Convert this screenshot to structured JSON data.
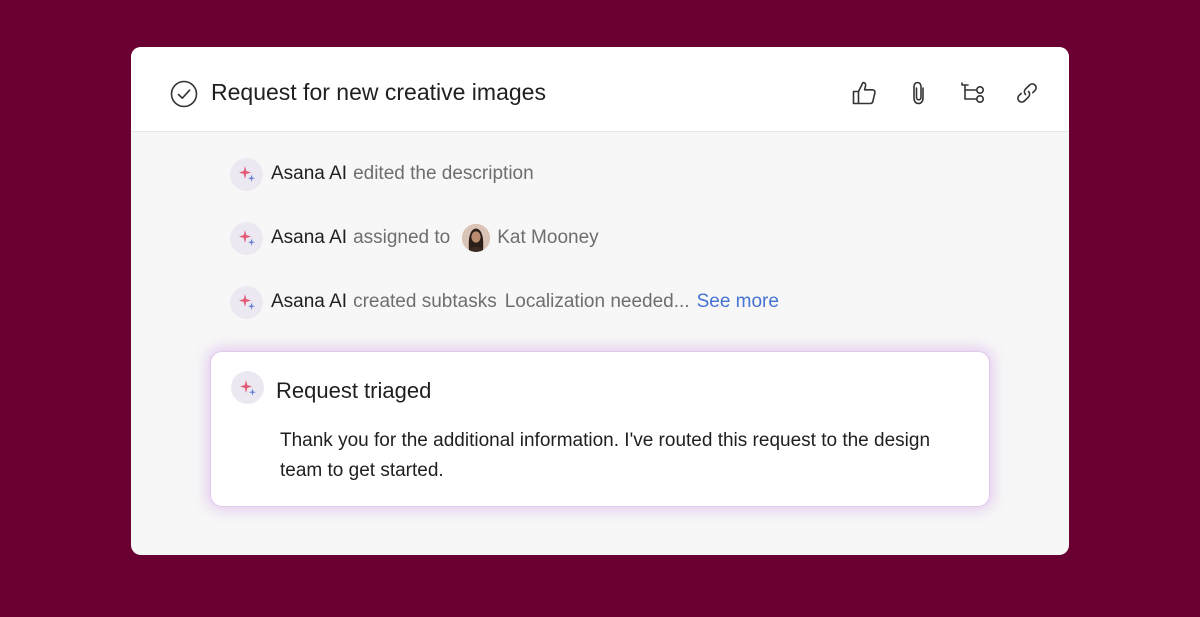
{
  "task": {
    "title": "Request for new creative images",
    "actions": [
      {
        "icon": "thumbs-up-icon",
        "label": "Like"
      },
      {
        "icon": "paperclip-icon",
        "label": "Attach"
      },
      {
        "icon": "subtasks-icon",
        "label": "Subtasks"
      },
      {
        "icon": "link-icon",
        "label": "Copy link"
      }
    ]
  },
  "activity": [
    {
      "actor": "Asana AI",
      "verb": "edited the description"
    },
    {
      "actor": "Asana AI",
      "verb": "assigned to",
      "assignee": "Kat Mooney"
    },
    {
      "actor": "Asana AI",
      "verb": "created subtasks",
      "subtasks": "Localization needed...",
      "see_more": "See more"
    }
  ],
  "triage_card": {
    "title": "Request triaged",
    "body": "Thank you for the additional information. I've routed this request to the design team to get started."
  },
  "colors": {
    "background": "#690031",
    "panel": "#f7f7f7",
    "link": "#4573d2",
    "ai_glow": "#e4c9ee"
  }
}
